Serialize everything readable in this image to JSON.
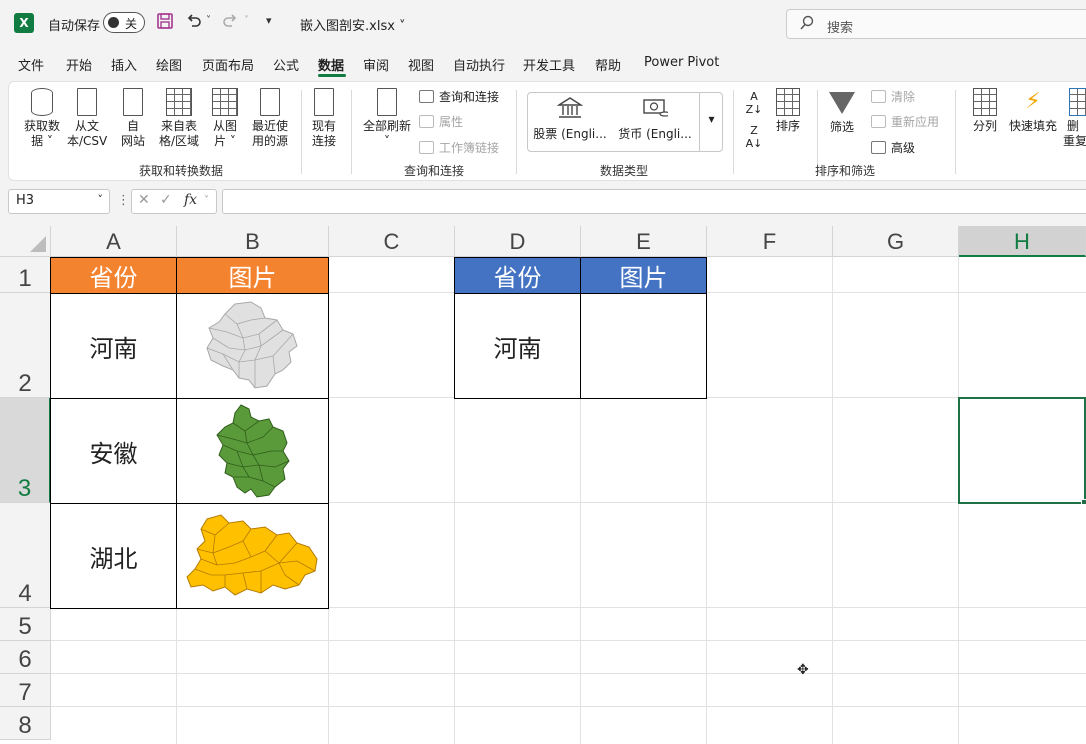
{
  "titlebar": {
    "app_logo": "X",
    "autosave_label": "自动保存",
    "autosave_state": "关",
    "filename": "嵌入图剖安.xlsx",
    "search_placeholder": "搜索"
  },
  "menu": {
    "items": [
      "文件",
      "开始",
      "插入",
      "绘图",
      "页面布局",
      "公式",
      "数据",
      "审阅",
      "视图",
      "自动执行",
      "开发工具",
      "帮助",
      "Power Pivot"
    ],
    "active": "数据"
  },
  "ribbon": {
    "get_data": "获取数\n据 ˅",
    "from_text": "从文\n本/CSV",
    "from_web": "自\n网站",
    "from_table": "来自表\n格/区域",
    "from_picture": "从图\n片 ˅",
    "recent_sources": "最近使\n用的源",
    "existing_conn": "现有\n连接",
    "group1_label": "获取和转换数据",
    "refresh_all": "全部刷新\n˅",
    "queries_conn": "查询和连接",
    "properties": "属性",
    "edit_links": "工作簿链接",
    "group2_label": "查询和连接",
    "stocks": "股票 (Engli...",
    "currencies": "货币 (Engli...",
    "group3_label": "数据类型",
    "sort": "排序",
    "filter": "筛选",
    "clear": "清除",
    "reapply": "重新应用",
    "advanced": "高级",
    "group4_label": "排序和筛选",
    "text_to_columns": "分列",
    "flash_fill": "快速填充",
    "remove_dup": "删\n重复"
  },
  "formula_bar": {
    "name_box": "H3",
    "fx": "fx",
    "content": ""
  },
  "sheet": {
    "columns": [
      "A",
      "B",
      "C",
      "D",
      "E",
      "F",
      "G",
      "H"
    ],
    "rows": [
      "1",
      "2",
      "3",
      "4",
      "5",
      "6",
      "7",
      "8"
    ],
    "selected_cell": "H3",
    "table1": {
      "header_province": "省份",
      "header_picture": "图片",
      "rows": [
        {
          "province": "河南",
          "map_color": "#e0e0e0",
          "map_name": "henan-map-image"
        },
        {
          "province": "安徽",
          "map_color": "#5b9a3a",
          "map_name": "anhui-map-image"
        },
        {
          "province": "湖北",
          "map_color": "#ffc000",
          "map_name": "hubei-map-image"
        }
      ]
    },
    "table2": {
      "header_province": "省份",
      "header_picture": "图片",
      "row_province": "河南",
      "row_picture": ""
    }
  },
  "colors": {
    "accent": "#107c41",
    "header_orange": "#f4832f",
    "header_blue": "#4473c4"
  }
}
